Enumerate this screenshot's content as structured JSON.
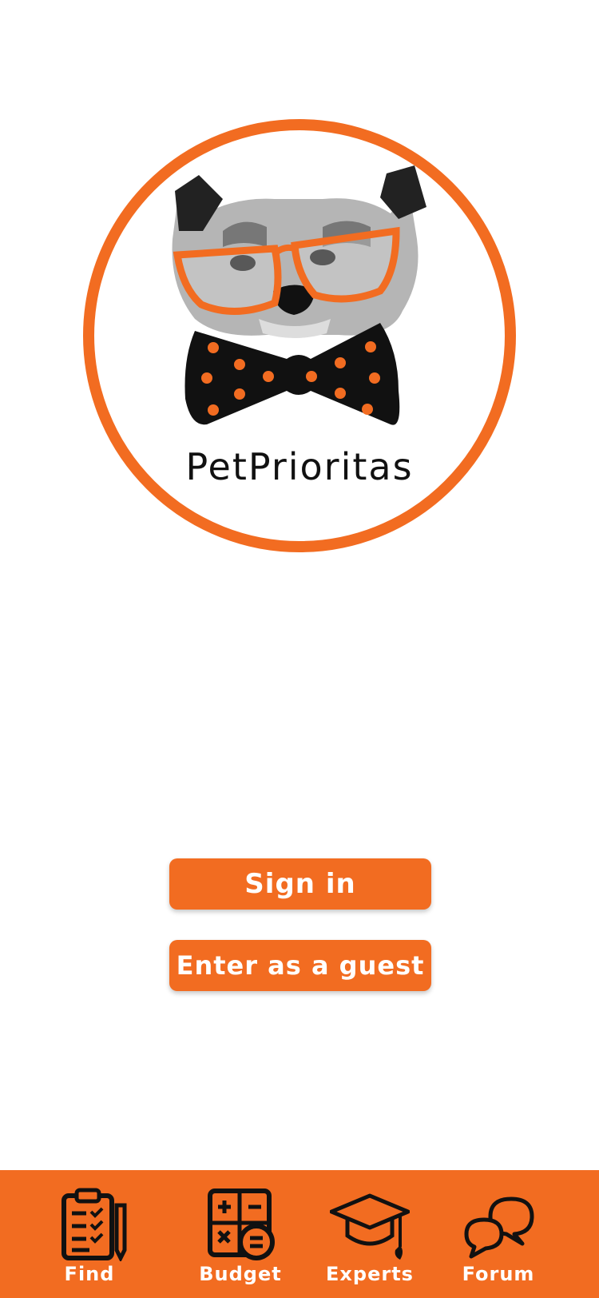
{
  "brand": {
    "name": "PetPrioritas",
    "accent_color": "#F26C21"
  },
  "actions": {
    "sign_in_label": "Sign in",
    "guest_label": "Enter as a guest"
  },
  "tabbar": {
    "items": [
      {
        "label": "Find",
        "icon": "clipboard-checklist-icon"
      },
      {
        "label": "Budget",
        "icon": "calculator-icon"
      },
      {
        "label": "Experts",
        "icon": "graduation-cap-icon"
      },
      {
        "label": "Forum",
        "icon": "speech-bubbles-icon"
      }
    ]
  }
}
